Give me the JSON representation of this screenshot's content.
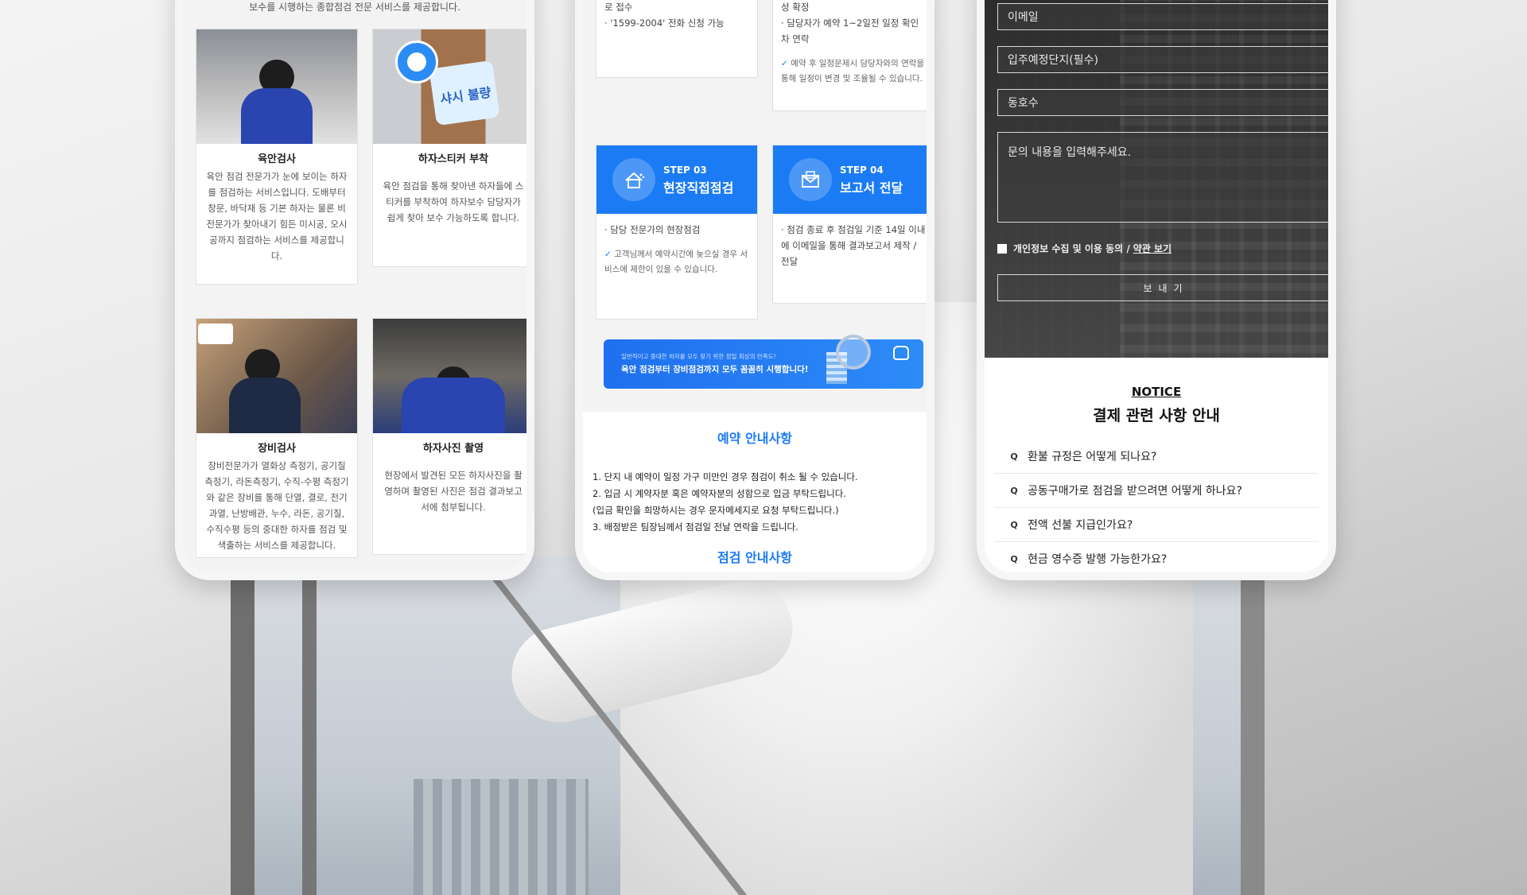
{
  "phone1": {
    "intro": "보수를 시행하는 종합점검 전문 서비스를 제공합니다.",
    "cards": [
      {
        "title": "육안검사",
        "desc": "육안 점검 전문가가 눈에 보이는 하자를 점검하는 서비스입니다. 도배부터 창문, 바닥재 등 기본 하자는 물론 비전문가가 찾아내기 힘든 미시공, 오시공까지 점검하는 서비스를 제공합니다."
      },
      {
        "title": "하자스티커 부착",
        "desc": "육안 점검을 통해 찾아낸 하자들에 스티커를 부착하여 하자보수 담당자가 쉽게 찾아 보수 가능하도록 합니다.",
        "sticker": "샤시 불량"
      },
      {
        "title": "장비검사",
        "desc": "장비전문가가 열화상 측정기, 공기질 측정기, 라돈측정기, 수직-수평 측정기와 같은 장비를 통해 단열, 결로, 전기과열, 난방배관, 누수, 라돈, 공기질, 수직수평 등의 중대한 하자를 점검 및 색출하는 서비스를 제공합니다."
      },
      {
        "title": "하자사진 촬영",
        "desc": "현장에서 발견된 모든 하자사진을 촬영하며 촬영된 사진은 점검 결과보고서에 첨부됩니다."
      }
    ]
  },
  "phone2": {
    "step1_top": "로 접수",
    "step1_item": "· '1599-2004' 전화 신청 가능",
    "step2_top": "성 확정",
    "step2_item": "· 담당자가 예약 1~2일전 일정 확인 차 연락",
    "step2_note": "예약 후 일정문제시 담당자와의 연락을 통해 일정이 변경 및 조율될 수 있습니다.",
    "steps": [
      {
        "no": "STEP 03",
        "name": "현장직접점검",
        "item": "· 담당 전문가의 현장점검",
        "note": "고객님께서 예약시간에 늦으실 경우 서비스에 제한이 있을 수 있습니다."
      },
      {
        "no": "STEP 04",
        "name": "보고서 전달",
        "item": "· 점검 종료 후 점검일 기준 14일 이내에 이메일을 통해 결과보고서 제작 / 전달",
        "note": ""
      }
    ],
    "check_mark": "✓",
    "banner_small": "일반적이고 중대한 하자를 모두 찾기 위한 정밀 최상의 만족도!",
    "banner_big": "육안 점검부터 장비점검까지 모두 꼼꼼히 시행합니다!",
    "reservation_title": "예약 안내사항",
    "reservation_list": [
      "1. 단지 내 예약이 일정 가구 미만인 경우 점검이 취소 될 수 있습니다.",
      "2. 입금 시 계약자분 혹은 예약자분의 성함으로 입금 부탁드립니다.",
      "(입금 확인을 희망하시는 경우 문자메세지로 요청 부탁드립니다.)",
      "3. 배정받은 팀장님께서 점검일 전날 연락을 드립니다."
    ],
    "inspection_title": "점검 안내사항"
  },
  "phone3": {
    "fields": {
      "email": "이메일",
      "complex": "입주예정단지(필수)",
      "unit": "동호수",
      "inquiry": "문의 내용을 입력해주세요."
    },
    "agree_label": "개인정보 수집 및 이용 동의 /",
    "terms_link": "약관 보기",
    "send_label": "보내기",
    "notice_eyebrow": "NOTICE",
    "notice_title": "결제 관련 사항 안내",
    "faq_marker": "Q",
    "faq": [
      "환불 규정은 어떻게 되나요?",
      "공동구매가로 점검을 받으려면 어떻게 하나요?",
      "전액 선불 지급인가요?",
      "현금 영수증 발행 가능한가요?"
    ]
  },
  "colors": {
    "accent": "#1b7bf5",
    "dark_panel": "#3a3a3a"
  }
}
